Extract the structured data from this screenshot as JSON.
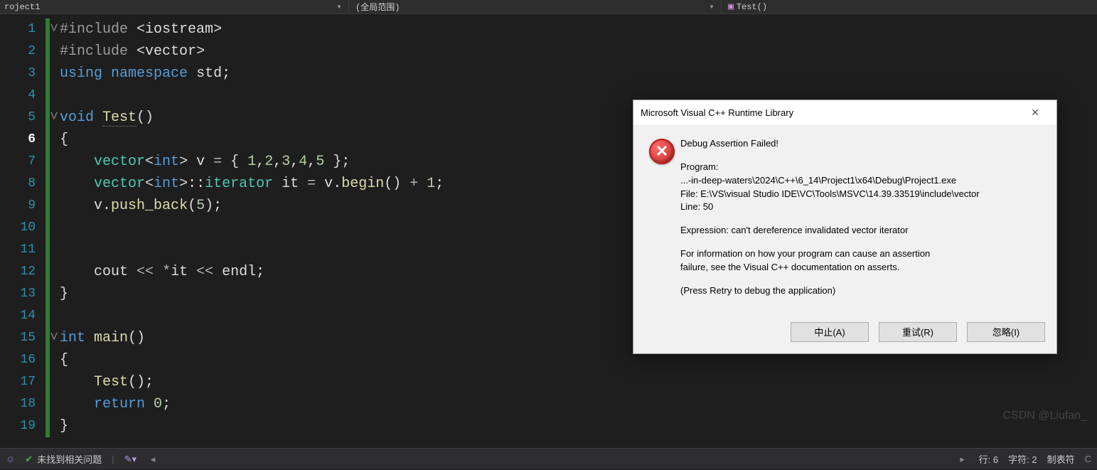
{
  "topbar": {
    "project": "roject1",
    "scope": "(全局范围)",
    "fn_icon": "▣",
    "fn": "Test()"
  },
  "code": {
    "lines": [
      {
        "n": "1",
        "fold": "˅",
        "html": "<span class='pre'>#include</span> <span class='pn'>&lt;</span><span class='id'>iostream</span><span class='pn'>&gt;</span>"
      },
      {
        "n": "2",
        "fold": "",
        "html": "<span class='pre'>#include</span> <span class='pn'>&lt;</span><span class='id'>vector</span><span class='pn'>&gt;</span>"
      },
      {
        "n": "3",
        "fold": "",
        "html": "<span class='kw'>using</span> <span class='kw'>namespace</span> <span class='id'>std</span><span class='pn'>;</span>"
      },
      {
        "n": "4",
        "fold": "",
        "html": ""
      },
      {
        "n": "5",
        "fold": "˅",
        "html": "<span class='kw'>void</span> <span class='func hint'>Test</span><span class='pn'>()</span>"
      },
      {
        "n": "6",
        "fold": "",
        "current": true,
        "html": "<span class='pn'>{</span>"
      },
      {
        "n": "7",
        "fold": "",
        "indent": 1,
        "html": "<span class='ty'>vector</span><span class='pn'>&lt;</span><span class='kw'>int</span><span class='pn'>&gt;</span> <span class='id'>v</span> <span class='op'>=</span> <span class='pn'>{</span> <span class='num'>1</span><span class='pn'>,</span><span class='num'>2</span><span class='pn'>,</span><span class='num'>3</span><span class='pn'>,</span><span class='num'>4</span><span class='pn'>,</span><span class='num'>5</span> <span class='pn'>};</span>"
      },
      {
        "n": "8",
        "fold": "",
        "indent": 1,
        "html": "<span class='ty'>vector</span><span class='pn'>&lt;</span><span class='kw'>int</span><span class='pn'>&gt;::</span><span class='ty'>iterator</span> <span class='id'>it</span> <span class='op'>=</span> <span class='id'>v</span><span class='pn'>.</span><span class='func'>begin</span><span class='pn'>()</span> <span class='op'>+</span> <span class='num'>1</span><span class='pn'>;</span>"
      },
      {
        "n": "9",
        "fold": "",
        "indent": 1,
        "html": "<span class='id'>v</span><span class='pn'>.</span><span class='func'>push_back</span><span class='pn'>(</span><span class='num'>5</span><span class='pn'>);</span>"
      },
      {
        "n": "10",
        "fold": "",
        "html": ""
      },
      {
        "n": "11",
        "fold": "",
        "html": ""
      },
      {
        "n": "12",
        "fold": "",
        "indent": 1,
        "html": "<span class='id'>cout</span> <span class='op'>&lt;&lt;</span> <span class='op'>*</span><span class='id'>it</span> <span class='op'>&lt;&lt;</span> <span class='id'>endl</span><span class='pn'>;</span>"
      },
      {
        "n": "13",
        "fold": "",
        "html": "<span class='pn'>}</span>"
      },
      {
        "n": "14",
        "fold": "",
        "html": ""
      },
      {
        "n": "15",
        "fold": "˅",
        "html": "<span class='kw'>int</span> <span class='func'>main</span><span class='pn'>()</span>"
      },
      {
        "n": "16",
        "fold": "",
        "html": "<span class='pn'>{</span>"
      },
      {
        "n": "17",
        "fold": "",
        "indent": 1,
        "html": "<span class='func'>Test</span><span class='pn'>();</span>"
      },
      {
        "n": "18",
        "fold": "",
        "indent": 1,
        "html": "<span class='kw'>return</span> <span class='num'>0</span><span class='pn'>;</span>"
      },
      {
        "n": "19",
        "fold": "",
        "html": "<span class='pn'>}</span>"
      }
    ]
  },
  "dialog": {
    "title": "Microsoft Visual C++ Runtime Library",
    "heading": "Debug Assertion Failed!",
    "program_label": "Program:",
    "program_path": "...-in-deep-waters\\2024\\C++\\6_14\\Project1\\x64\\Debug\\Project1.exe",
    "file_line": "File: E:\\VS\\visual Studio IDE\\VC\\Tools\\MSVC\\14.39.33519\\include\\vector",
    "line_line": "Line: 50",
    "expr": "Expression: can't dereference invalidated vector iterator",
    "info1": "For information on how your program can cause an assertion",
    "info2": "failure, see the Visual C++ documentation on asserts.",
    "retry_hint": "(Press Retry to debug the application)",
    "btn_abort": "中止(A)",
    "btn_retry": "重试(R)",
    "btn_ignore": "忽略(I)"
  },
  "status": {
    "problems_icon": "✔",
    "problems_text": "未找到相关问题",
    "line_label": "行:",
    "line_val": "6",
    "col_label": "字符:",
    "col_val": "2",
    "tabs_label": "制表符"
  },
  "watermark": "CSDN @Liufan_"
}
